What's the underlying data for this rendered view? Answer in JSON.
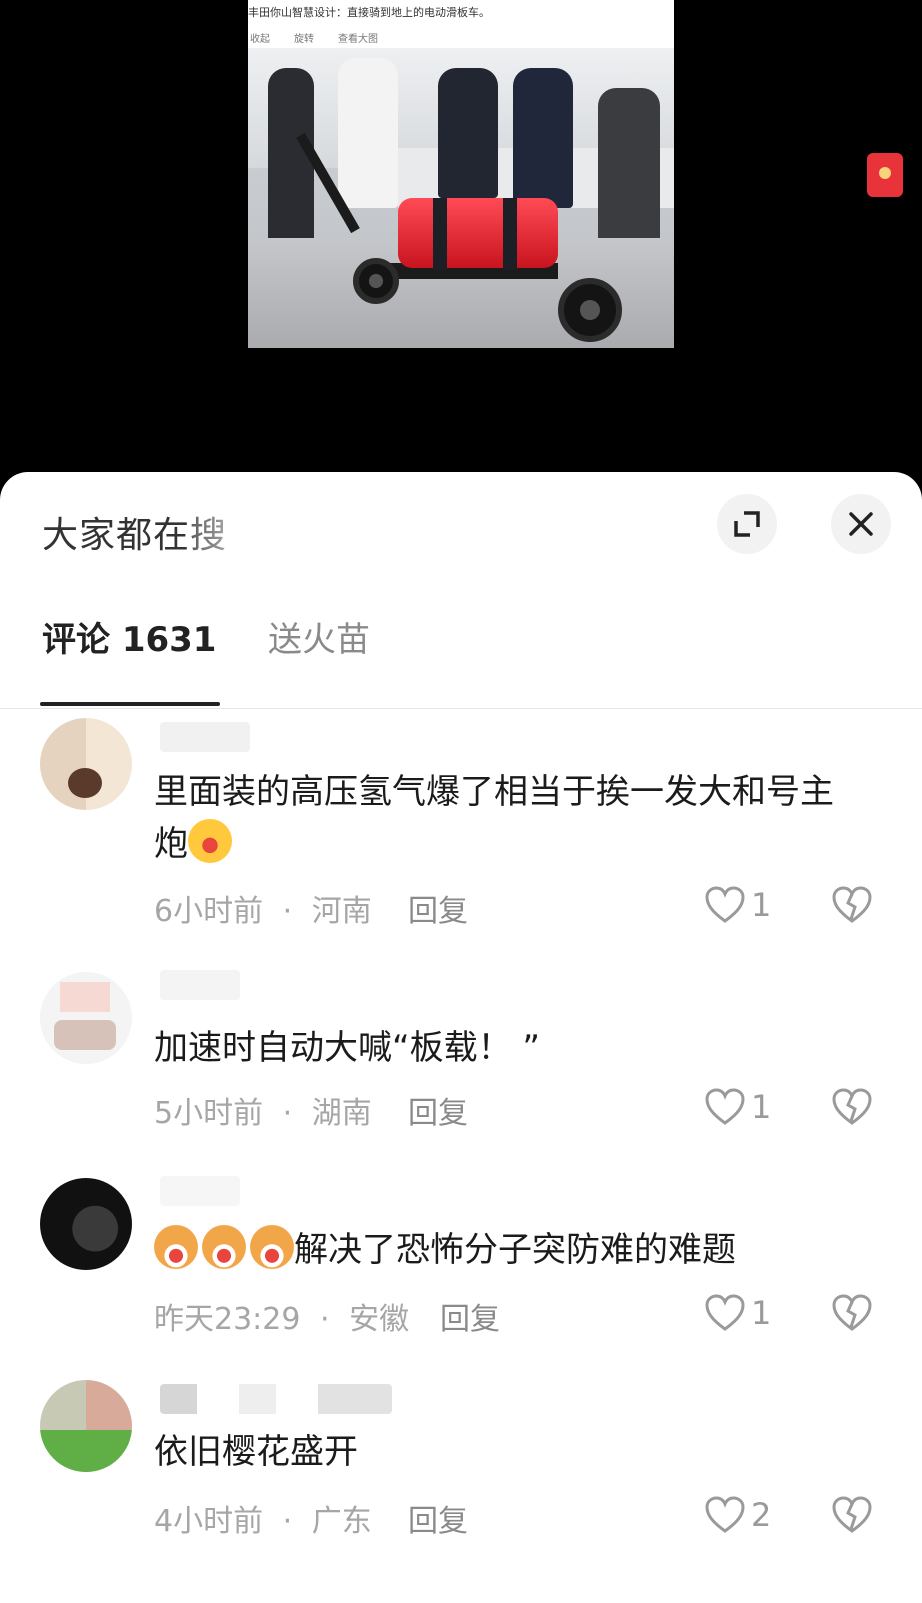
{
  "post": {
    "caption": "丰田你山智慧设计：直接骑到地上的电动滑板车。",
    "actions": [
      "收起",
      "旋转",
      "查看大图"
    ]
  },
  "sheet": {
    "title": "大家都在搜",
    "tabs": [
      {
        "label": "评论 1631"
      },
      {
        "label": "送火苗"
      }
    ]
  },
  "comments": [
    {
      "text": "里面装的高压氢气爆了相当于挨一发大和号主炮",
      "time": "6小时前",
      "location": "河南",
      "reply_label": "回复",
      "likes": "1"
    },
    {
      "text": "加速时自动大喊“板载！ ”",
      "time": "5小时前",
      "location": "湖南",
      "reply_label": "回复",
      "likes": "1"
    },
    {
      "text": "解决了恐怖分子突防难的难题",
      "time": "昨天23:29",
      "location": "安徽",
      "reply_label": "回复",
      "likes": "1"
    },
    {
      "text": "依旧樱花盛开",
      "time": "4小时前",
      "location": "广东",
      "reply_label": "回复",
      "likes": "2"
    }
  ],
  "separator": "·",
  "colors": {
    "sheet_bg": "#ffffff",
    "muted_text": "#a6a6a6",
    "red_packet": "#e8333a"
  },
  "icons": [
    "expand-icon",
    "close-icon",
    "heart-icon",
    "broken-heart-icon",
    "red-packet-icon"
  ]
}
